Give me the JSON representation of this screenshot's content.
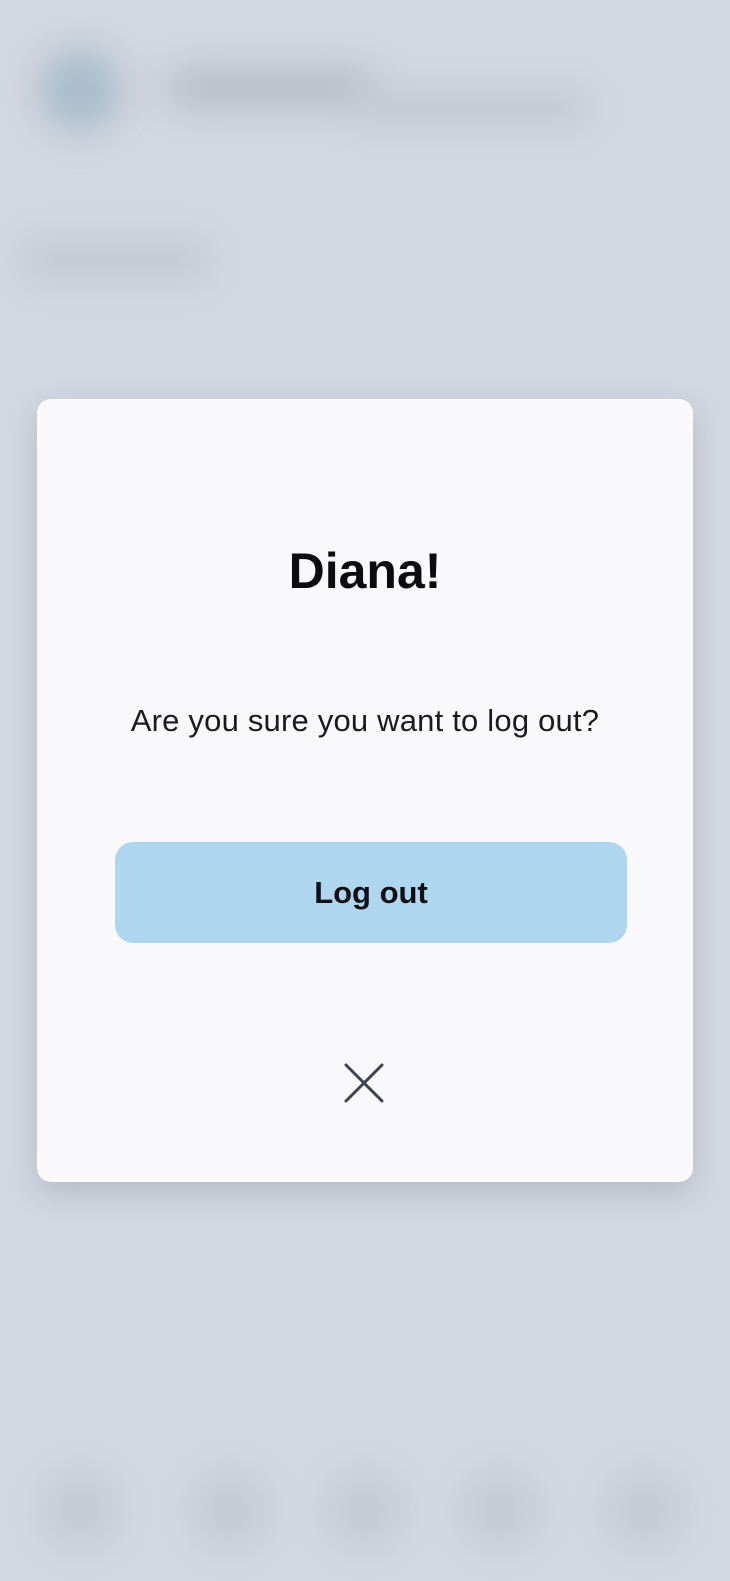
{
  "dialog": {
    "title": "Diana!",
    "message": "Are you sure you want to log out?",
    "logout_label": "Log out",
    "close_icon": "close-icon"
  },
  "colors": {
    "backdrop": "#d3d7e0",
    "dialog_background": "#f9f9fc",
    "button_background": "#aed6ee",
    "text_primary": "#0c0c10",
    "close_icon": "#3b4450"
  }
}
